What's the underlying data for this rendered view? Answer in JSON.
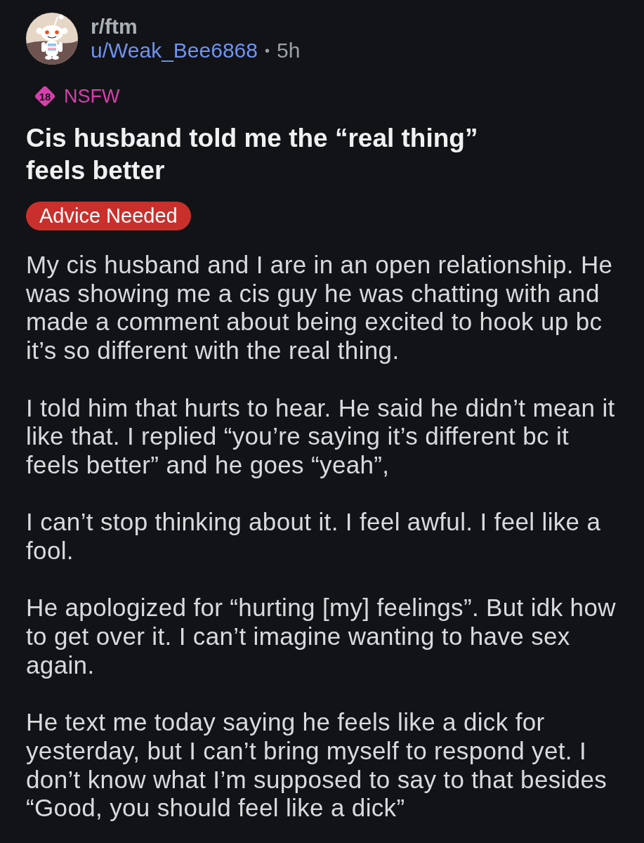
{
  "post": {
    "subreddit": "r/ftm",
    "author": "u/Weak_Bee6868",
    "separator": "•",
    "age": "5h",
    "nsfw": {
      "badge": "18",
      "label": "NSFW"
    },
    "title": "Cis husband told me the “real thing” feels better",
    "flair": {
      "label": "Advice Needed"
    },
    "body": [
      "My cis husband and I are in an open relationship. He was showing me a cis guy he was chatting with and made a comment about being excited to hook up bc it’s so different with the real thing.",
      "I told him that hurts to hear. He said he didn’t mean it like that. I replied “you’re saying it’s different bc it feels better” and he goes “yeah”,",
      "I can’t stop thinking about it. I feel awful. I feel like a fool.",
      "He apologized for “hurting [my] feelings”. But idk how to get over it. I can’t imagine wanting to have sex again.",
      "He text me today saying he feels like a dick for yesterday, but I can’t bring myself to respond yet. I don’t know what I’m supposed to say to that besides “Good, you should feel like a dick”"
    ]
  }
}
